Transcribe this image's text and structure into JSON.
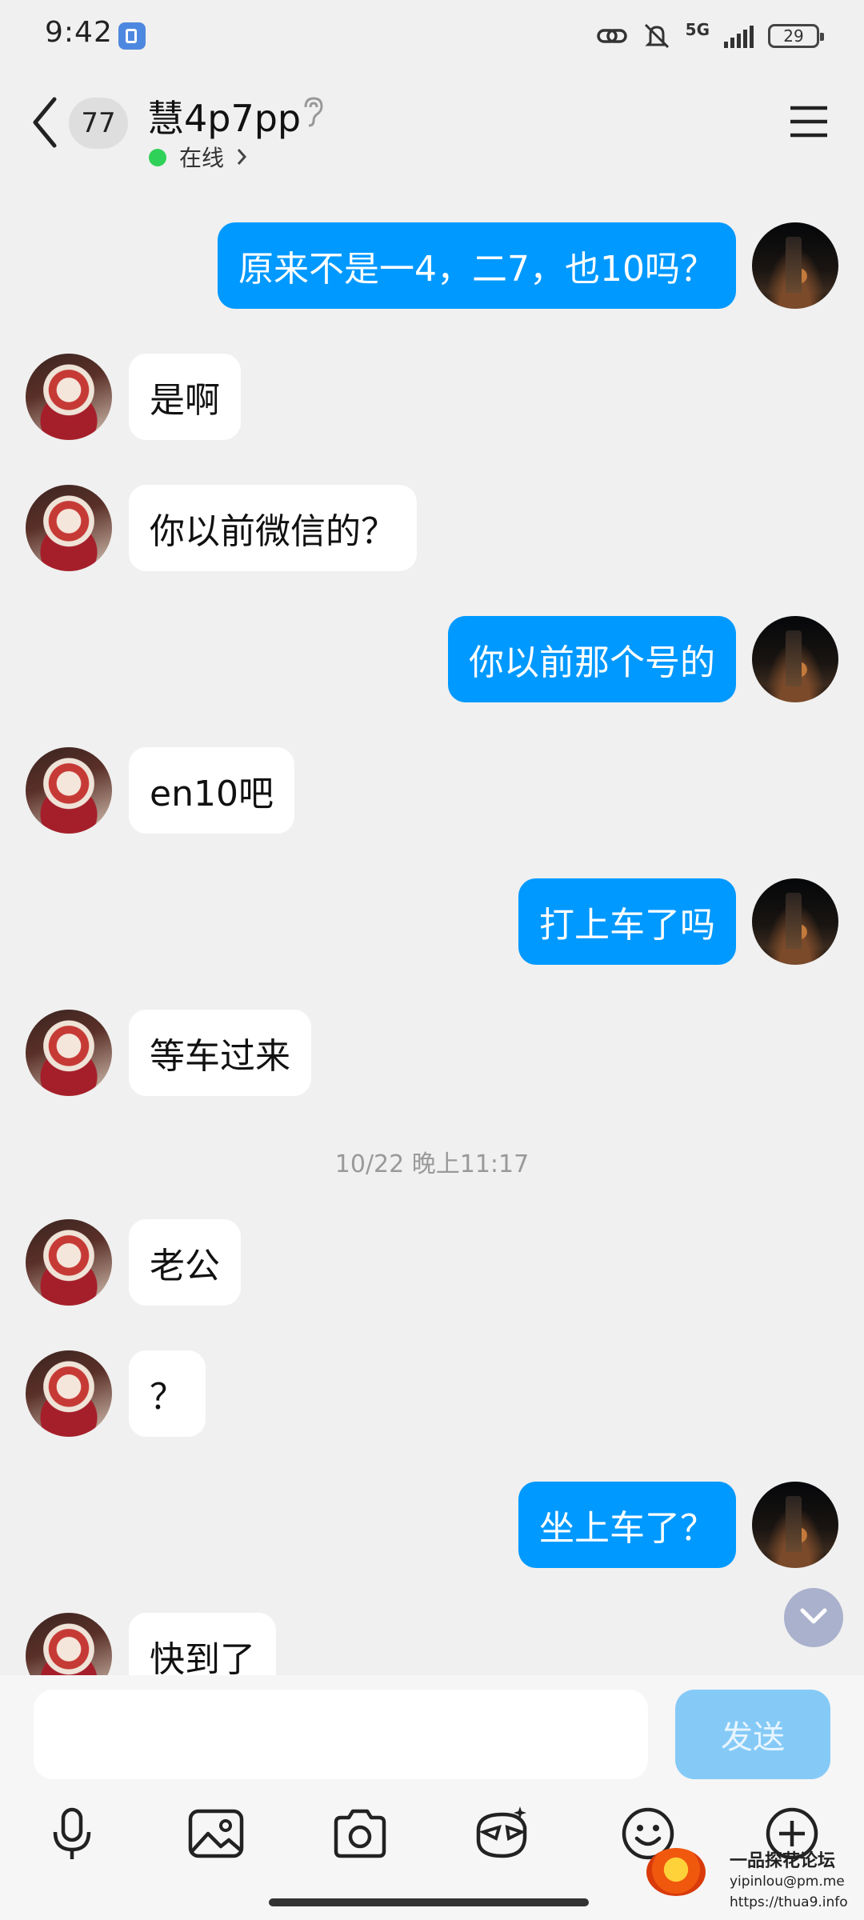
{
  "status_bar": {
    "time": "9:42",
    "network": "5G",
    "battery": "29"
  },
  "header": {
    "unread_count": "77",
    "contact_name": "慧4p7pp",
    "online_status": "在线"
  },
  "messages": [
    {
      "side": "mine",
      "text": "原来不是一4，二7，也10吗？"
    },
    {
      "side": "other",
      "text": "是啊"
    },
    {
      "side": "other",
      "text": "你以前微信的？"
    },
    {
      "side": "mine",
      "text": "你以前那个号的"
    },
    {
      "side": "other",
      "text": "en10吧"
    },
    {
      "side": "mine",
      "text": "打上车了吗"
    },
    {
      "side": "other",
      "text": "等车过来"
    },
    {
      "side": "time",
      "text": "10/22 晚上11:17"
    },
    {
      "side": "other",
      "text": "老公"
    },
    {
      "side": "other",
      "text": "？"
    },
    {
      "side": "mine",
      "text": "坐上车了？"
    },
    {
      "side": "other",
      "text": "快到了"
    }
  ],
  "composer": {
    "input_value": "",
    "input_placeholder": "",
    "send_label": "发送"
  },
  "toolbar": [
    "microphone-icon",
    "image-icon",
    "camera-icon",
    "sticker-icon",
    "emoji-icon",
    "plus-icon"
  ],
  "watermark": {
    "title": "一品探花论坛",
    "email": "yipinlou@pm.me",
    "url": "https://thua9.info"
  },
  "colors": {
    "my_bubble": "#0099ff",
    "other_bubble": "#ffffff",
    "background": "#f0f0f0",
    "online": "#30d158"
  }
}
